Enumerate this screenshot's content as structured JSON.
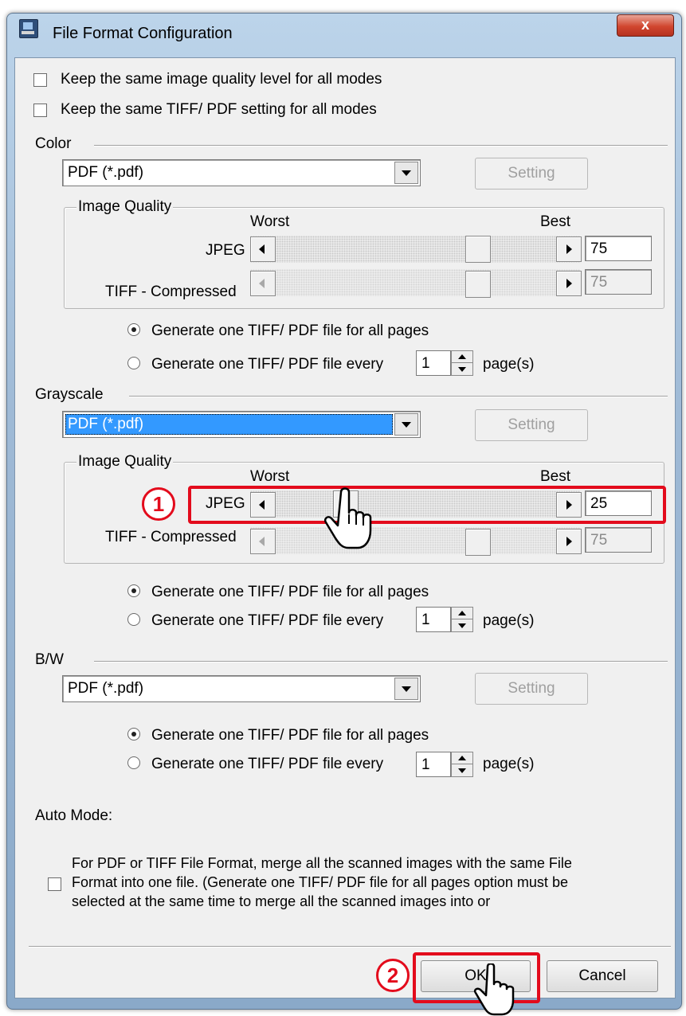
{
  "window": {
    "title": "File Format Configuration",
    "close_label": "x"
  },
  "options": {
    "keep_quality": "Keep the same image quality level for all modes",
    "keep_tiff_pdf": "Keep the same TIFF/ PDF setting for all modes"
  },
  "color": {
    "section_label": "Color",
    "format": "PDF (*.pdf)",
    "setting_label": "Setting",
    "image_quality": {
      "group_label": "Image Quality",
      "worst_label": "Worst",
      "best_label": "Best",
      "jpeg_label": "JPEG",
      "jpeg_value": "75",
      "jpeg_level": 75,
      "tiff_label": "TIFF - Compressed",
      "tiff_value": "75",
      "tiff_level": 75
    },
    "radio_all": "Generate one TIFF/ PDF file for all pages",
    "radio_every": "Generate one TIFF/ PDF file every",
    "every_value": "1",
    "pages_label": "page(s)"
  },
  "grayscale": {
    "section_label": "Grayscale",
    "format": "PDF (*.pdf)",
    "setting_label": "Setting",
    "image_quality": {
      "group_label": "Image Quality",
      "worst_label": "Worst",
      "best_label": "Best",
      "jpeg_label": "JPEG",
      "jpeg_value": "25",
      "jpeg_level": 25,
      "tiff_label": "TIFF - Compressed",
      "tiff_value": "75",
      "tiff_level": 75
    },
    "radio_all": "Generate one TIFF/ PDF file for all pages",
    "radio_every": "Generate one TIFF/ PDF file every",
    "every_value": "1",
    "pages_label": "page(s)"
  },
  "bw": {
    "section_label": "B/W",
    "format": "PDF (*.pdf)",
    "setting_label": "Setting",
    "radio_all": "Generate one TIFF/ PDF file for all pages",
    "radio_every": "Generate one TIFF/ PDF file every",
    "every_value": "1",
    "pages_label": "page(s)"
  },
  "auto_mode": {
    "label": "Auto Mode:",
    "merge_line1": "For PDF or TIFF File Format, merge all the scanned images with the same File",
    "merge_line2": "Format into one file. (Generate one TIFF/ PDF file for all pages option must be",
    "merge_line3": "selected at the same time to merge all the scanned images into or"
  },
  "footer": {
    "ok_label": "OK",
    "cancel_label": "Cancel"
  },
  "annotations": {
    "step1": "1",
    "step2": "2",
    "highlight_color": "#e30b1c"
  }
}
